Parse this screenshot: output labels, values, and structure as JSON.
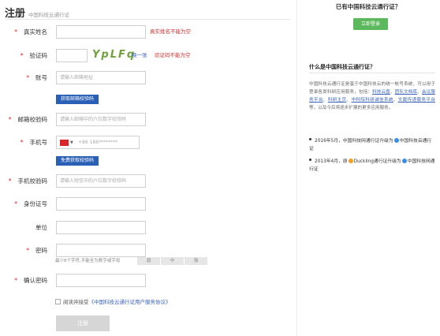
{
  "header": {
    "title": "注册",
    "subtitle": "中国科技云通行证"
  },
  "form": {
    "real_name": {
      "label": "真实姓名",
      "value": "",
      "error": "真实姓名不能为空"
    },
    "captcha": {
      "label": "验证码",
      "value": "",
      "code": "YpLFq",
      "swap_label": "换一张",
      "error": "验证码不能为空"
    },
    "account": {
      "label": "账号",
      "placeholder": "请输入邮箱地址"
    },
    "get_email_code_button": "获取邮箱校验码",
    "email_code": {
      "label": "邮箱校验码",
      "placeholder": "请输入邮箱中的六位数字校验码"
    },
    "phone": {
      "label": "手机号",
      "country_code": "+86 186********"
    },
    "get_sms_code_button": "免费获取校验码",
    "phone_code": {
      "label": "手机校验码",
      "placeholder": "请输入短信中的六位数字校验码"
    },
    "id_number": {
      "label": "身份证号"
    },
    "organization": {
      "label": "单位"
    },
    "password": {
      "label": "密码",
      "hint": "最少8个字符,不能全为数字或字母",
      "strength": [
        "弱",
        "中",
        "强"
      ]
    },
    "confirm_password": {
      "label": "确认密码"
    },
    "agreement": {
      "prefix": "阅读并接受",
      "link": "《中国科技云通行证用户服务协议》"
    },
    "submit": "注册"
  },
  "sidebar": {
    "question": "已有中国科技云通行证？",
    "login_button": "立即登录",
    "about_title": "什么是中国科技云通行证？",
    "about_text_1": "中国科技云通行证是基于中国科技云的统一帐号系统，可以用于登录各类科研应用服务，包括：",
    "about_links": [
      "科技云盘",
      "团队文档库",
      "会议服务平台",
      "科研主页",
      "中科院科研诚信系统",
      "文献传递服务平台"
    ],
    "about_sep": "、",
    "about_text_2": "等，以及今后将逐步扩展的更多应用服务。",
    "news": [
      {
        "prefix": "2016年5月，",
        "mid": "中国科技网通行证升级为",
        "suffix": "中国科技云通行证"
      },
      {
        "prefix": "2013年4月，原",
        "mid": "Duckling通行证升级为",
        "suffix": "中国科技网通行证"
      }
    ]
  }
}
